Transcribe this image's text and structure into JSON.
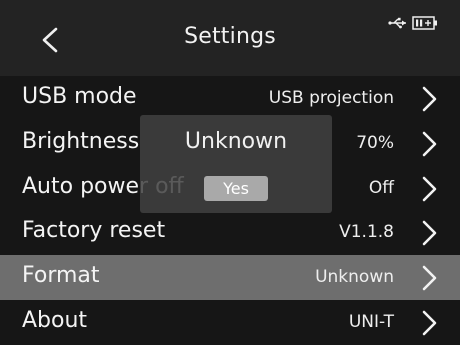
{
  "header": {
    "title": "Settings",
    "back_icon": "chevron-left-icon",
    "status_icons": [
      "usb-icon",
      "battery-icon"
    ]
  },
  "settings": {
    "items": [
      {
        "label": "USB mode",
        "value": "USB projection"
      },
      {
        "label": "Brightness",
        "value": "70%"
      },
      {
        "label": "Auto power off",
        "value": "Off"
      },
      {
        "label": "Factory reset",
        "value": "V1.1.8"
      },
      {
        "label": "Format",
        "value": "Unknown",
        "selected": true
      },
      {
        "label": "About",
        "value": "UNI-T"
      }
    ]
  },
  "dialog": {
    "message": "Unknown",
    "confirm_label": "Yes"
  },
  "colors": {
    "background": "#161616",
    "header": "#232323",
    "selected_row": "#6e6e6e",
    "text": "#f4f4f4"
  }
}
